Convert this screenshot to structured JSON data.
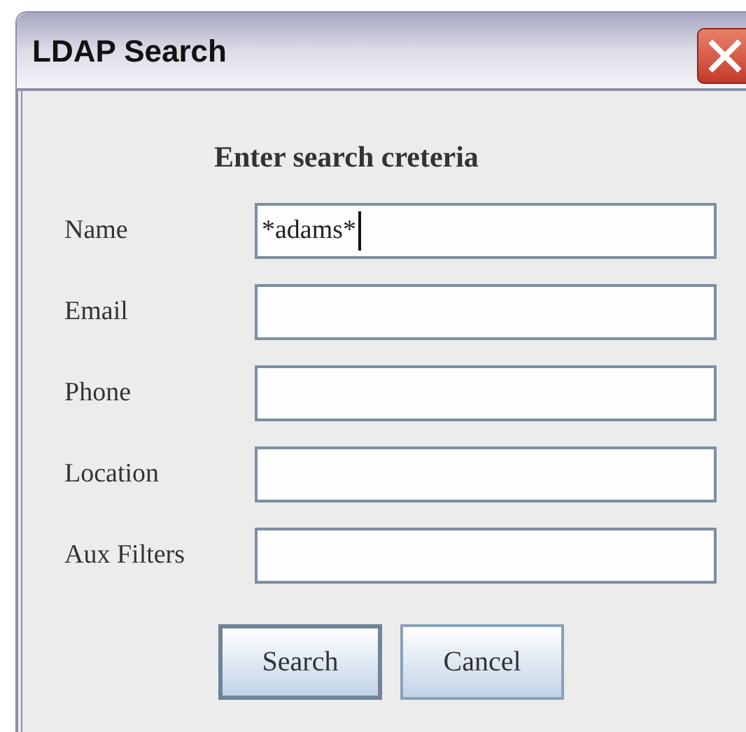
{
  "window": {
    "title": "LDAP Search"
  },
  "heading": "Enter search creteria",
  "fields": [
    {
      "label": "Name",
      "value": "*adams*",
      "focused": true
    },
    {
      "label": "Email",
      "focused": false
    },
    {
      "label": "Phone",
      "focused": false
    },
    {
      "label": "Location",
      "focused": false
    },
    {
      "label": "Aux Filters",
      "focused": false
    }
  ],
  "buttons": [
    {
      "label": "Search",
      "default": true
    },
    {
      "label": "Cancel",
      "default": false
    }
  ]
}
